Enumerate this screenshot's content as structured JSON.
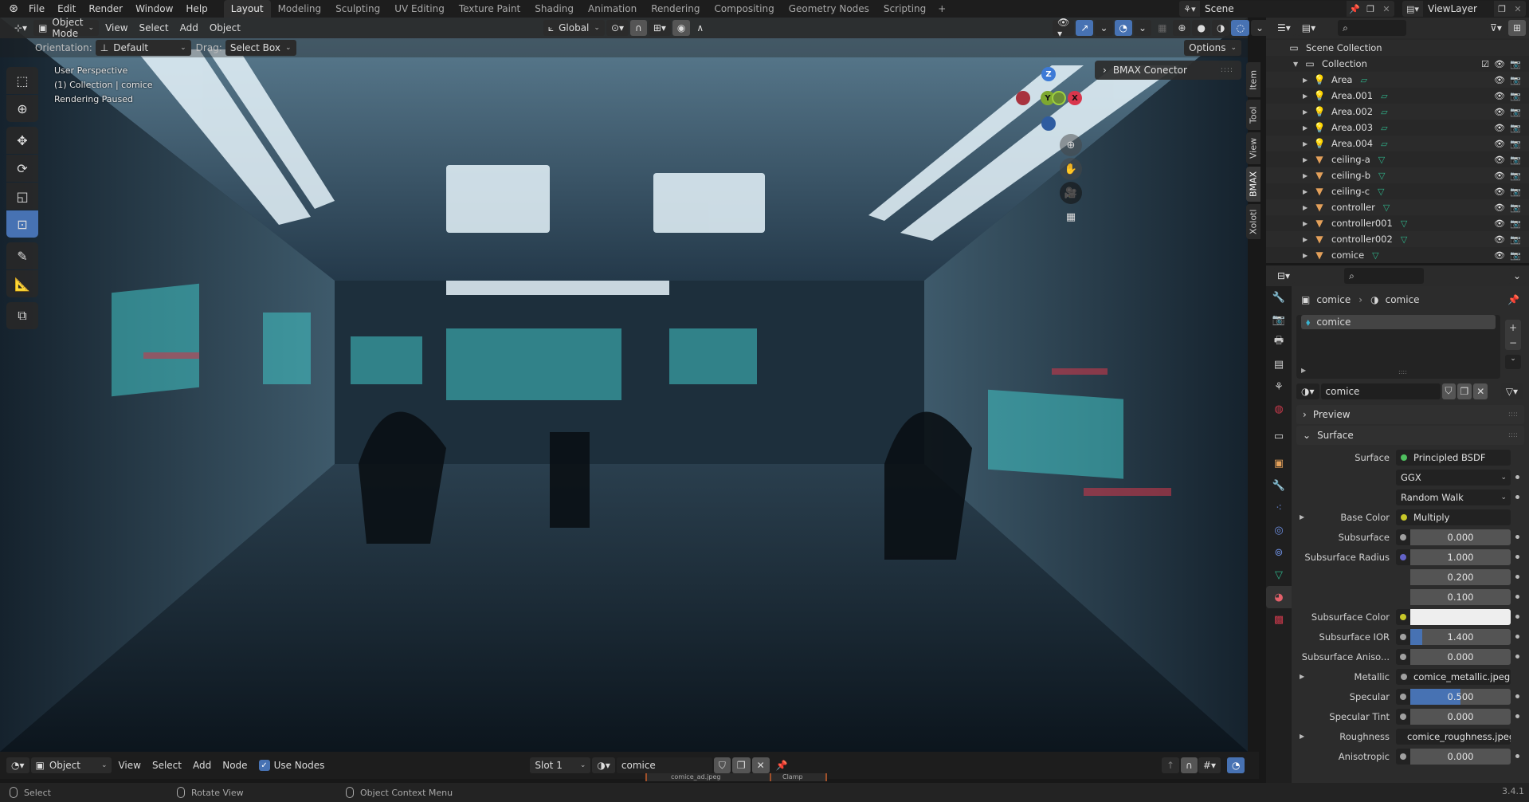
{
  "topbar": {
    "menus": [
      "File",
      "Edit",
      "Render",
      "Window",
      "Help"
    ],
    "workspaces": [
      "Layout",
      "Modeling",
      "Sculpting",
      "UV Editing",
      "Texture Paint",
      "Shading",
      "Animation",
      "Rendering",
      "Compositing",
      "Geometry Nodes",
      "Scripting"
    ],
    "active_workspace": "Layout",
    "add_workspace": "+",
    "scene": "Scene",
    "view_layer": "ViewLayer"
  },
  "viewport": {
    "mode": "Object Mode",
    "menus": [
      "View",
      "Select",
      "Add",
      "Object"
    ],
    "orientation_label": "Orientation:",
    "orientation_value": "Default",
    "drag_label": "Drag:",
    "drag_value": "Select Box",
    "transform_orientation": "Global",
    "options_label": "Options",
    "overlay_lines": [
      "User Perspective",
      "(1) Collection | comice",
      "Rendering Paused"
    ],
    "gizmo": {
      "z": "Z",
      "y": "Y",
      "x": "X"
    },
    "bmax_panel": "BMAX Conector",
    "n_tabs": [
      "Item",
      "Tool",
      "View",
      "BMAX",
      "Xolotl"
    ],
    "active_n_tab": "BMAX",
    "tools": [
      "select-box",
      "cursor",
      "move",
      "rotate",
      "scale",
      "transform",
      "annotate",
      "measure",
      "add-cube"
    ],
    "active_tool": "transform"
  },
  "node_editor": {
    "mode": "Object",
    "menus": [
      "View",
      "Select",
      "Add",
      "Node"
    ],
    "use_nodes_label": "Use Nodes",
    "use_nodes": true,
    "slot": "Slot 1",
    "material": "comice",
    "node_snippets": [
      "comice_ad.jpeg",
      "Clamp"
    ]
  },
  "statusbar": {
    "left": "Select",
    "middle": "Rotate View",
    "right": "Object Context Menu",
    "version": "3.4.1"
  },
  "outliner": {
    "root": "Scene Collection",
    "collection": "Collection",
    "items": [
      {
        "name": "Area",
        "type": "light"
      },
      {
        "name": "Area.001",
        "type": "light"
      },
      {
        "name": "Area.002",
        "type": "light"
      },
      {
        "name": "Area.003",
        "type": "light"
      },
      {
        "name": "Area.004",
        "type": "light"
      },
      {
        "name": "ceiling-a",
        "type": "mesh"
      },
      {
        "name": "ceiling-b",
        "type": "mesh"
      },
      {
        "name": "ceiling-c",
        "type": "mesh"
      },
      {
        "name": "controller",
        "type": "mesh"
      },
      {
        "name": "controller001",
        "type": "mesh"
      },
      {
        "name": "controller002",
        "type": "mesh"
      },
      {
        "name": "comice",
        "type": "mesh"
      }
    ]
  },
  "properties": {
    "breadcrumb_object": "comice",
    "breadcrumb_material": "comice",
    "slot_item": "comice",
    "material_name": "comice",
    "preview_label": "Preview",
    "surface_label": "Surface",
    "rows": [
      {
        "label": "Surface",
        "kind": "link",
        "value": "Principled BSDF",
        "socket": "#4fbf5f"
      },
      {
        "label": "",
        "kind": "dropdown",
        "value": "GGX"
      },
      {
        "label": "",
        "kind": "dropdown",
        "value": "Random Walk"
      },
      {
        "label": "Base Color",
        "kind": "link",
        "value": "Multiply",
        "socket": "#c7c729",
        "expand": true
      },
      {
        "label": "Subsurface",
        "kind": "number",
        "value": "0.000",
        "fill": 0
      },
      {
        "label": "Subsurface Radius",
        "kind": "number",
        "value": "1.000",
        "socket": "#6363c7",
        "fill": 0
      },
      {
        "label": "",
        "kind": "number",
        "value": "0.200",
        "fill": 0,
        "nosock": true
      },
      {
        "label": "",
        "kind": "number",
        "value": "0.100",
        "fill": 0,
        "nosock": true
      },
      {
        "label": "Subsurface Color",
        "kind": "color",
        "value": "#eeeeee",
        "socket": "#c7c729"
      },
      {
        "label": "Subsurface IOR",
        "kind": "number",
        "value": "1.400",
        "fill": 0.12
      },
      {
        "label": "Subsurface Aniso...",
        "kind": "number",
        "value": "0.000",
        "fill": 0
      },
      {
        "label": "Metallic",
        "kind": "link",
        "value": "comice_metallic.jpeg",
        "socket": "#a0a0a0",
        "expand": true
      },
      {
        "label": "Specular",
        "kind": "number",
        "value": "0.500",
        "fill": 0.5
      },
      {
        "label": "Specular Tint",
        "kind": "number",
        "value": "0.000",
        "fill": 0
      },
      {
        "label": "Roughness",
        "kind": "link",
        "value": "comice_roughness.jpeg",
        "socket": "#a0a0a0",
        "expand": true
      },
      {
        "label": "Anisotropic",
        "kind": "number",
        "value": "0.000",
        "fill": 0
      }
    ]
  },
  "colors": {
    "accent": "#4772b3",
    "panel": "#2c2c2c",
    "header": "#1d1d1d",
    "light_icon": "#e3a05a",
    "data_icon": "#2fb38a"
  }
}
